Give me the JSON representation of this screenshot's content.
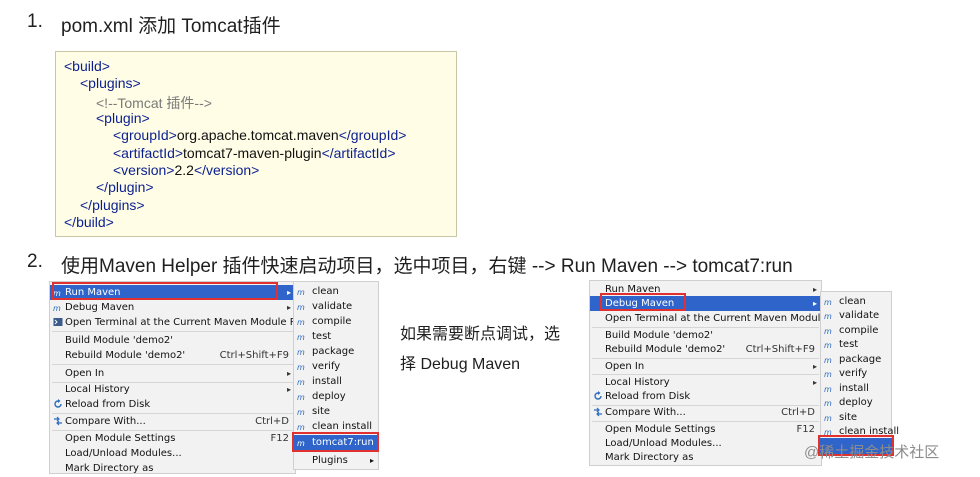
{
  "step1": {
    "num": "1.",
    "text": "pom.xml 添加 Tomcat插件"
  },
  "code": {
    "l1": "<build>",
    "l2": "<plugins>",
    "l3": "<!--Tomcat 插件-->",
    "l4": "<plugin>",
    "l5a": "<groupId>",
    "l5b": "org.apache.tomcat.maven",
    "l5c": "</groupId>",
    "l6a": "<artifactId>",
    "l6b": "tomcat7-maven-plugin",
    "l6c": "</artifactId>",
    "l7a": "<version>",
    "l7b": "2.2",
    "l7c": "</version>",
    "l8": "</plugin>",
    "l9": "</plugins>",
    "l10": "</build>"
  },
  "step2": {
    "num": "2.",
    "text": "使用Maven Helper 插件快速启动项目，选中项目，右键 --> Run Maven --> tomcat7:run"
  },
  "left_menu": {
    "items": [
      {
        "label": "Run Maven",
        "icon": "maven-icon",
        "arrow": "▸"
      },
      {
        "label": "Debug Maven",
        "icon": "maven-icon",
        "arrow": "▸"
      },
      {
        "label": "Open Terminal at the Current Maven Module Path",
        "icon": "terminal-icon"
      },
      {
        "label": "Build Module 'demo2'"
      },
      {
        "label": "Rebuild Module 'demo2'",
        "shortcut": "Ctrl+Shift+F9"
      },
      {
        "label": "Open In",
        "arrow": "▸"
      },
      {
        "label": "Local History",
        "arrow": "▸"
      },
      {
        "label": "Reload from Disk",
        "icon": "reload-icon"
      },
      {
        "label": "Compare With...",
        "icon": "compare-icon",
        "shortcut": "Ctrl+D"
      },
      {
        "label": "Open Module Settings",
        "shortcut": "F12"
      },
      {
        "label": "Load/Unload Modules..."
      },
      {
        "label": "Mark Directory as"
      }
    ]
  },
  "left_sub": {
    "items": [
      "clean",
      "validate",
      "compile",
      "test",
      "package",
      "verify",
      "install",
      "deploy",
      "site",
      "clean install",
      "tomcat7:run",
      "Plugins"
    ]
  },
  "note": {
    "line1": "如果需要断点调试，选",
    "line2": "择 Debug Maven"
  },
  "right_menu": {
    "items": [
      {
        "label": "Run Maven",
        "arrow": "▸"
      },
      {
        "label": "Debug Maven",
        "arrow": "▸"
      },
      {
        "label": "Open Terminal at the Current Maven Module Path"
      },
      {
        "label": "Build Module 'demo2'"
      },
      {
        "label": "Rebuild Module 'demo2'",
        "shortcut": "Ctrl+Shift+F9"
      },
      {
        "label": "Open In",
        "arrow": "▸"
      },
      {
        "label": "Local History",
        "arrow": "▸"
      },
      {
        "label": "Reload from Disk"
      },
      {
        "label": "Compare With...",
        "shortcut": "Ctrl+D"
      },
      {
        "label": "Open Module Settings",
        "shortcut": "F12"
      },
      {
        "label": "Load/Unload Modules..."
      },
      {
        "label": "Mark Directory as"
      }
    ]
  },
  "right_sub": {
    "items": [
      "clean",
      "validate",
      "compile",
      "test",
      "package",
      "verify",
      "install",
      "deploy",
      "site",
      "clean install"
    ]
  },
  "watermark": "@稀土掘金技术社区",
  "colors": {
    "selection": "#2f65ca",
    "highlight": "#e03030",
    "code_bg": "#fffde6",
    "tag": "#0a1f8f"
  }
}
